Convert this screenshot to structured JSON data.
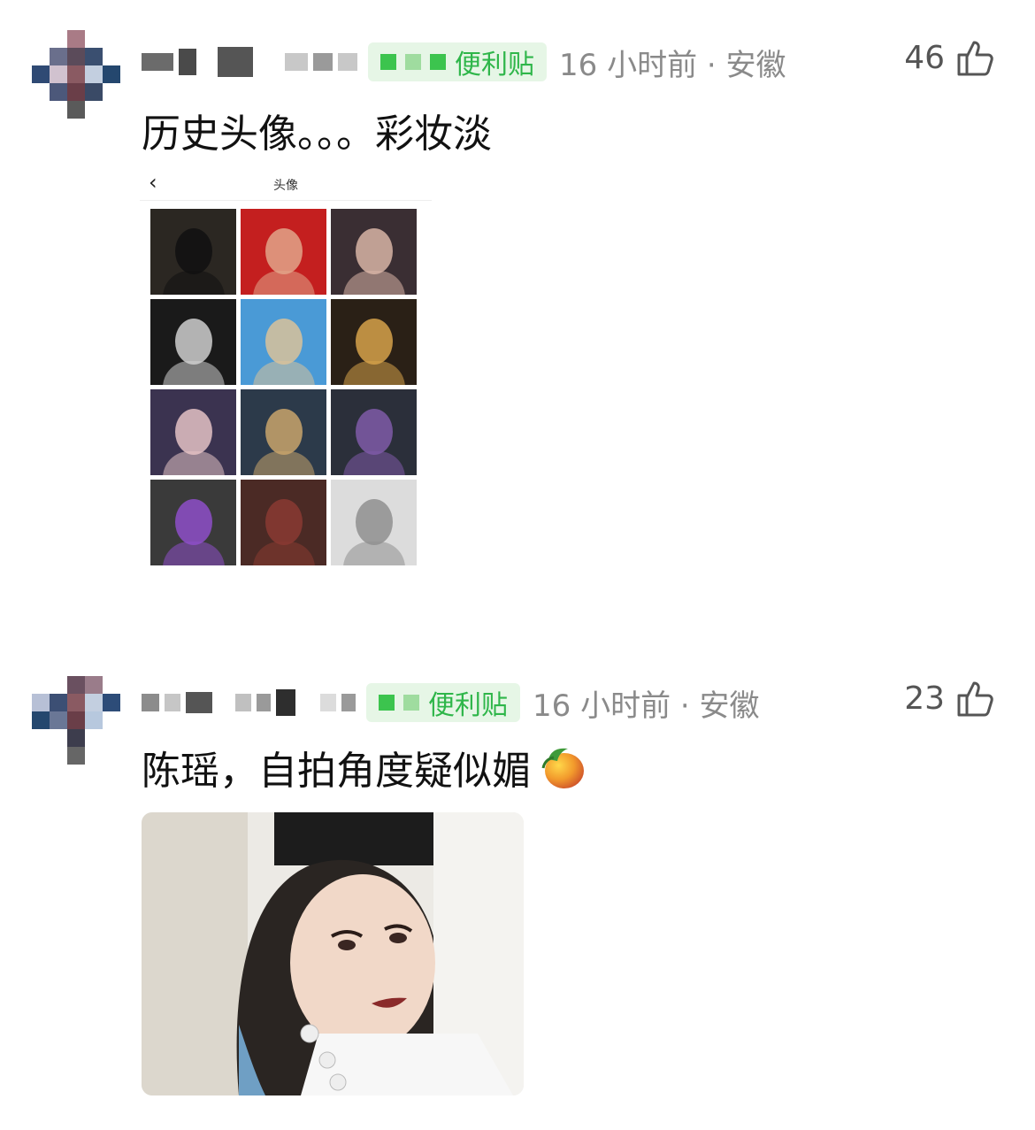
{
  "comments": [
    {
      "badge": "便利贴",
      "time_location": "16 小时前 · 安徽",
      "likes": "46",
      "text": "历史头像。。。彩妆淡",
      "image": {
        "title": "头像",
        "back_icon": "chevron-left-icon",
        "tiles": [
          {
            "bg": "#2b2722",
            "accent": "#111111"
          },
          {
            "bg": "#c41f1f",
            "accent": "#e2a58a"
          },
          {
            "bg": "#3a2e33",
            "accent": "#d8b4a6"
          },
          {
            "bg": "#1a1a1a",
            "accent": "#cfcfcf"
          },
          {
            "bg": "#4a9ad6",
            "accent": "#d9c29a"
          },
          {
            "bg": "#2a2016",
            "accent": "#d6a24a"
          },
          {
            "bg": "#3b3350",
            "accent": "#e4c2c4"
          },
          {
            "bg": "#2c3a4a",
            "accent": "#c9a46b"
          },
          {
            "bg": "#2b2f3a",
            "accent": "#7f5aa8"
          },
          {
            "bg": "#3a3a3a",
            "accent": "#8e4fc9"
          },
          {
            "bg": "#4b2a25",
            "accent": "#8a3a32"
          },
          {
            "bg": "#dcdcdc",
            "accent": "#8f8f8f"
          }
        ]
      }
    },
    {
      "badge": "便利贴",
      "time_location": "16 小时前 · 安徽",
      "likes": "23",
      "text": "陈瑶，自拍角度疑似媚",
      "emoji_icon": "mango-icon"
    }
  ],
  "colors": {
    "badge_text": "#2fb64a",
    "badge_bg": "#e6f6e6",
    "meta_gray": "#8a8a8a"
  }
}
